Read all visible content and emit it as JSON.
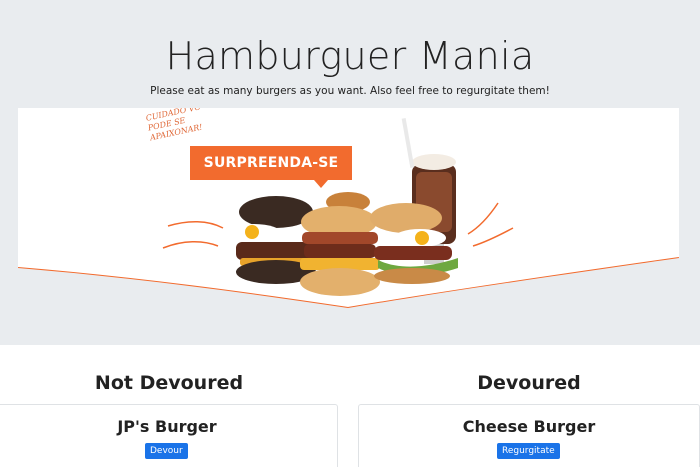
{
  "header": {
    "title": "Hamburguer Mania",
    "subtitle": "Please eat as many burgers as you want. Also feel free to regurgitate them!"
  },
  "banner": {
    "badge": "SURPREENDA-SE",
    "note": "CUIDADO VC PODE SE APAIXONAR!"
  },
  "columns": {
    "left_heading": "Not Devoured",
    "right_heading": "Devoured"
  },
  "not_devoured": [
    {
      "name": "JP's Burger",
      "action": "Devour"
    }
  ],
  "devoured": [
    {
      "name": "Cheese Burger",
      "action": "Regurgitate"
    }
  ],
  "colors": {
    "accent_orange": "#f26b2e",
    "button_blue": "#1a73e8",
    "jumbotron_bg": "#e9ecef"
  }
}
